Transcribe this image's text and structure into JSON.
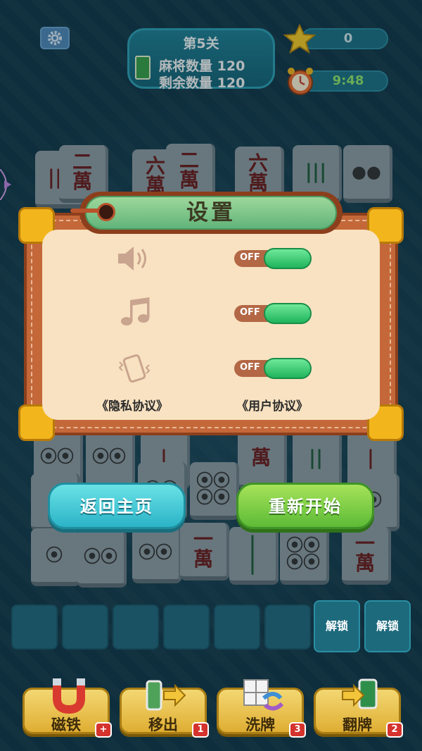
{
  "hud": {
    "level_title": "第5关",
    "tile_count_label": "麻将数量",
    "tile_count_value": "120",
    "remaining_label": "剩余数量",
    "remaining_value": "120",
    "score": "0",
    "timer": "9:48"
  },
  "board": {
    "tiles": [
      {
        "text": "二\n萬",
        "kind": "char"
      },
      {
        "text": "六\n萬",
        "kind": "char"
      },
      {
        "text": "二\n萬",
        "kind": "char"
      },
      {
        "text": "六\n萬",
        "kind": "char"
      },
      {
        "text": "|||",
        "kind": "bamboo"
      },
      {
        "text": "●●",
        "kind": "circle"
      },
      {
        "text": "萬",
        "kind": "char"
      },
      {
        "text": "⦿⦿",
        "kind": "circle"
      },
      {
        "text": "⦿⦿\n⦿⦿",
        "kind": "circle"
      },
      {
        "text": "⦿",
        "kind": "circle"
      },
      {
        "text": "一\n萬",
        "kind": "char"
      },
      {
        "text": "|\n|",
        "kind": "bamboo"
      },
      {
        "text": "⦿⦿\n⦿⦿",
        "kind": "circle"
      },
      {
        "text": "一\n萬",
        "kind": "char"
      }
    ]
  },
  "dialog": {
    "title": "设置",
    "settings": [
      {
        "icon": "speaker-icon",
        "state": "OFF"
      },
      {
        "icon": "music-note-icon",
        "state": "OFF"
      },
      {
        "icon": "vibration-icon",
        "state": "OFF"
      }
    ],
    "privacy_link": "《隐私协议》",
    "user_agreement_link": "《用户协议》"
  },
  "buttons": {
    "home": "返回主页",
    "restart": "重新开始"
  },
  "tray": {
    "locked_label_1": "解锁",
    "locked_label_2": "解锁"
  },
  "tools": [
    {
      "label": "磁铁",
      "badge": "+"
    },
    {
      "label": "移出",
      "badge": "1"
    },
    {
      "label": "洗牌",
      "badge": "3"
    },
    {
      "label": "翻牌",
      "badge": "2"
    }
  ],
  "colors": {
    "background": "#123748",
    "dialog_frame": "#c4683a",
    "dialog_panel": "#f8e2c1",
    "toggle_on": "#1fb45c",
    "home_button": "#2bb3c7",
    "restart_button": "#5dbb36",
    "tool_button": "#dfae33"
  }
}
